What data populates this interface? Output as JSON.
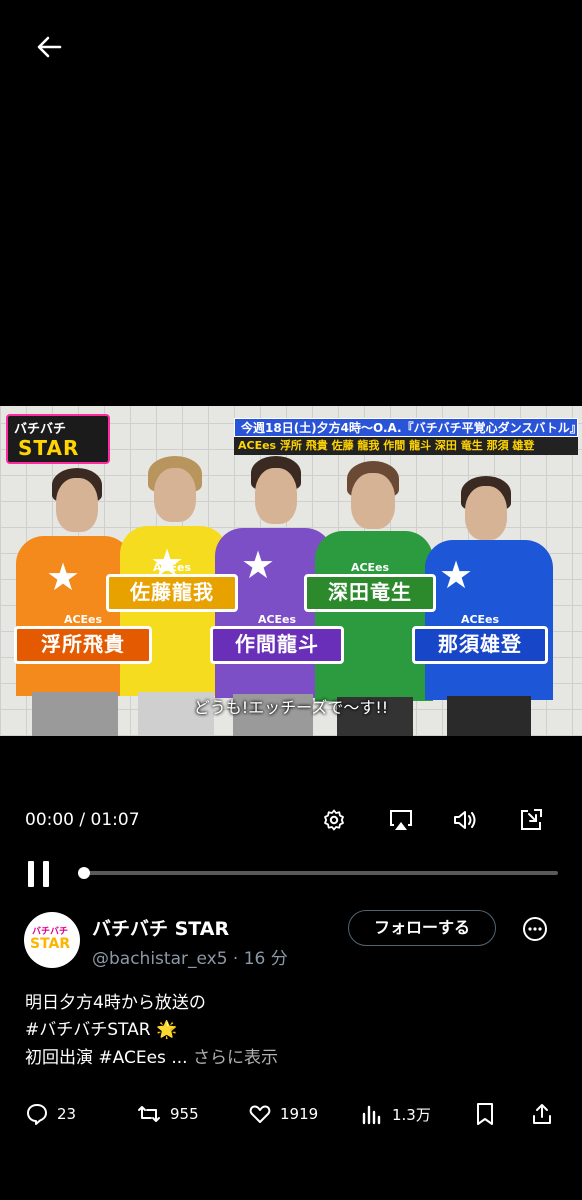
{
  "nav": {
    "back_label": "←"
  },
  "video": {
    "logo_top": "バチバチ",
    "logo_bottom": "STAR",
    "banner": "今週18日(土)夕方4時～O.A.『バチバチ平覚心ダンスバトル』",
    "names_bar": "ACEes 浮所 飛貴 佐藤 龍我 作間 龍斗 深田 竜生 那須 雄登",
    "members": [
      {
        "group": "ACEes",
        "name": "浮所飛貴",
        "shirt": "#f4891c"
      },
      {
        "group": "ACEes",
        "name": "佐藤龍我",
        "shirt": "#f6dc1e"
      },
      {
        "group": "ACEes",
        "name": "作間龍斗",
        "shirt": "#7d4fc6"
      },
      {
        "group": "ACEes",
        "name": "深田竜生",
        "shirt": "#2c9a3e"
      },
      {
        "group": "ACEes",
        "name": "那須雄登",
        "shirt": "#1d56d6"
      }
    ],
    "caption": "どうも!エッチーズで〜す!!"
  },
  "player": {
    "time": "00:00 / 01:07",
    "progress": 0,
    "icons": [
      "settings-icon",
      "airplay-icon",
      "volume-icon",
      "pip-icon",
      "pause-icon"
    ]
  },
  "post": {
    "account_name": "バチバチ STAR",
    "handle": "@bachistar_ex5 · 16 分",
    "follow_label": "フォローする",
    "line1": "明日夕方4時から放送の",
    "line2": "#バチバチSTAR 🌟",
    "line3_prefix": "初回出演 ",
    "line3_hashtag": "#ACEes",
    "line3_ellipsis": " ... ",
    "show_more": "さらに表示"
  },
  "actions": {
    "replies": "23",
    "reposts": "955",
    "likes": "1919",
    "views": "1.3万"
  }
}
